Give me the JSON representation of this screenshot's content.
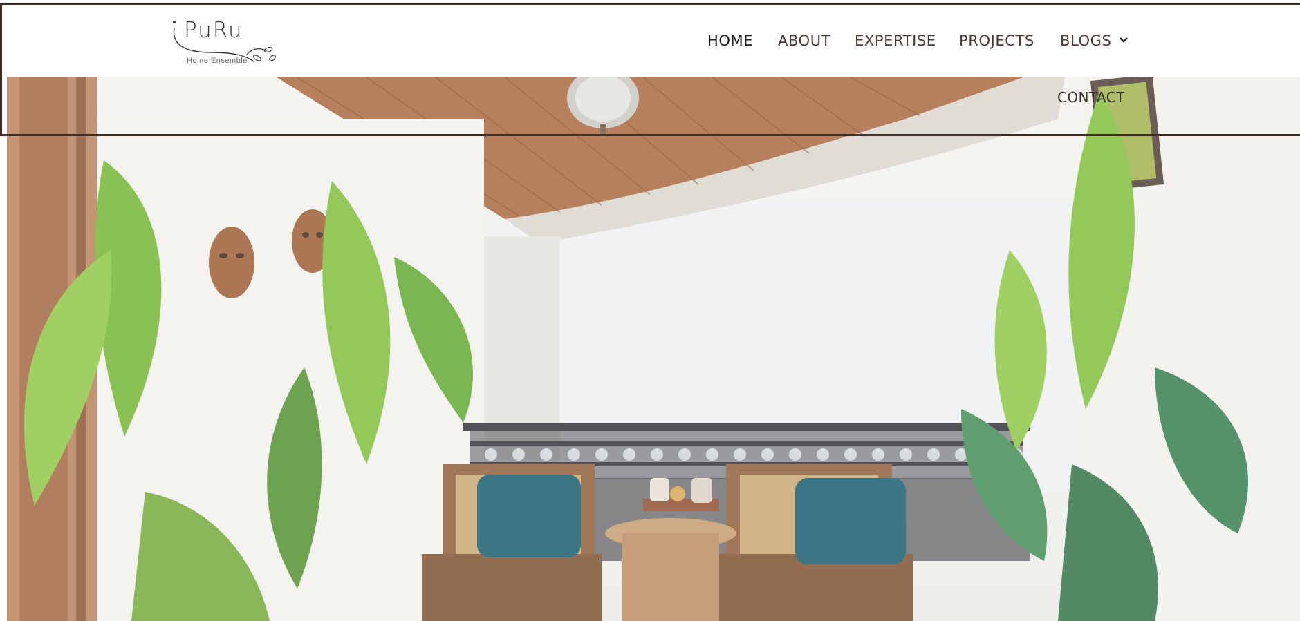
{
  "logo": {
    "name": "PuRu",
    "tagline": "Home Ensemble"
  },
  "nav": {
    "items": [
      {
        "label": "HOME",
        "active": true
      },
      {
        "label": "ABOUT",
        "active": false
      },
      {
        "label": "EXPERTISE",
        "active": false
      },
      {
        "label": "PROJECTS",
        "active": false
      },
      {
        "label": "BLOGS",
        "active": false,
        "icon": "chevron-down-icon"
      },
      {
        "label": "CONTACT",
        "active": false
      }
    ]
  },
  "hero": {
    "scene": "balcony-with-plants-and-chairs"
  },
  "colors": {
    "border": "#3d2d25",
    "nav_text": "#4a3a33",
    "nav_active": "#1a1a1a"
  }
}
